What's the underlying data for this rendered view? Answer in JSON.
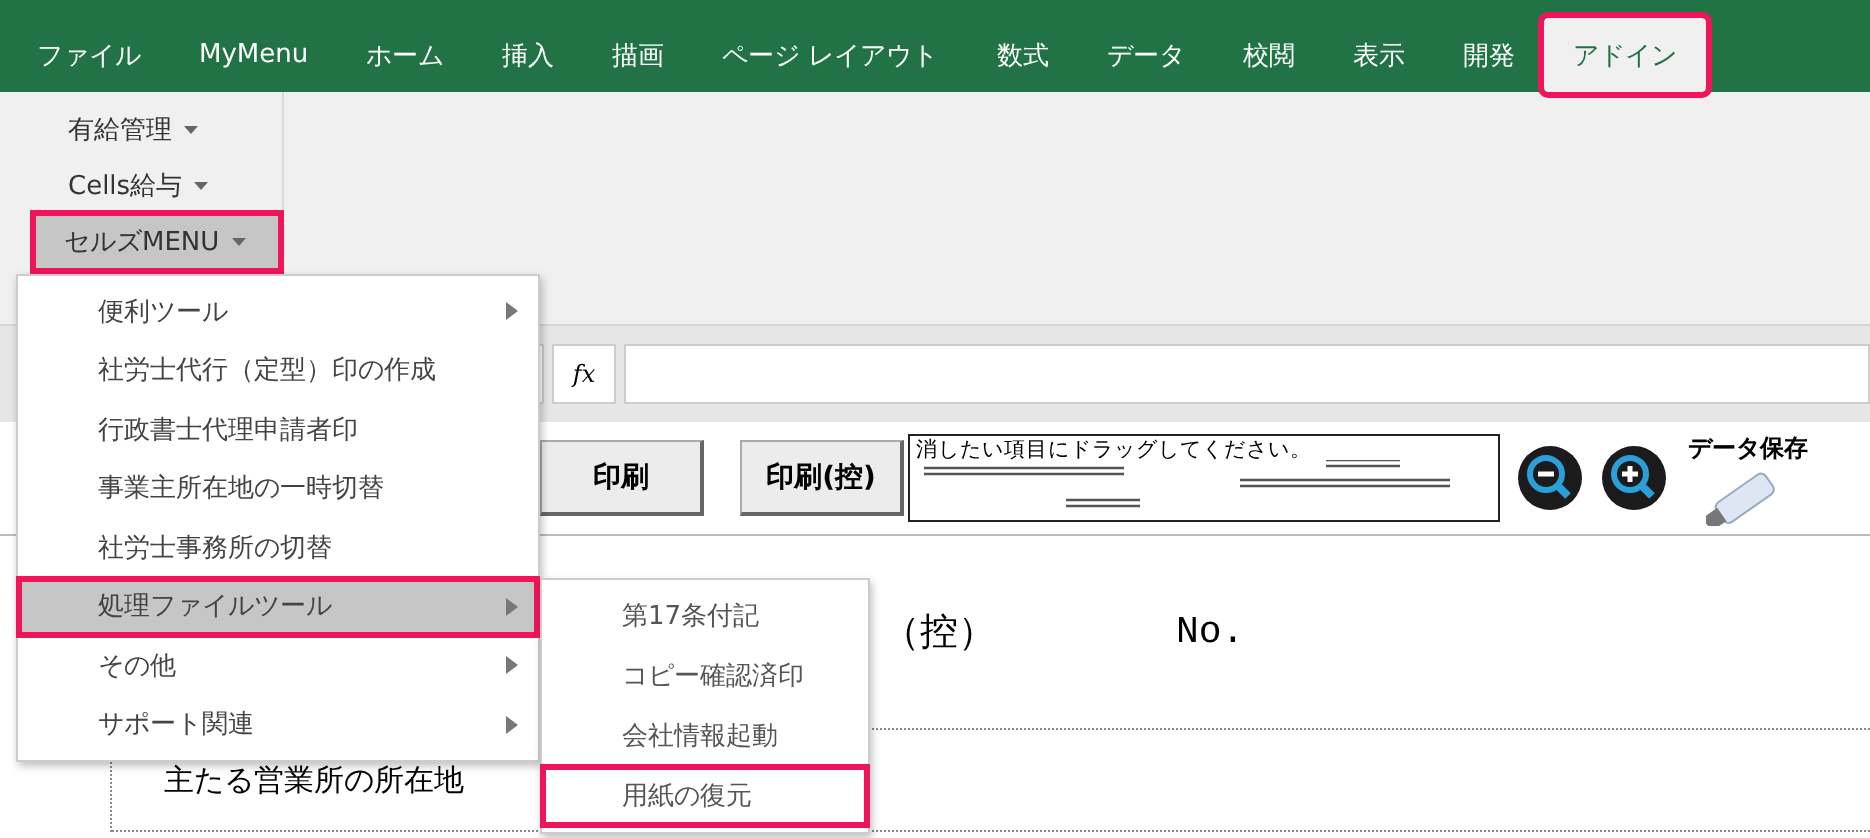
{
  "tabs": [
    {
      "label": "ファイル",
      "selected": false,
      "highlighted": false
    },
    {
      "label": "MyMenu",
      "selected": false,
      "highlighted": false
    },
    {
      "label": "ホーム",
      "selected": false,
      "highlighted": false
    },
    {
      "label": "挿入",
      "selected": false,
      "highlighted": false
    },
    {
      "label": "描画",
      "selected": false,
      "highlighted": false
    },
    {
      "label": "ページ レイアウト",
      "selected": false,
      "highlighted": false
    },
    {
      "label": "数式",
      "selected": false,
      "highlighted": false
    },
    {
      "label": "データ",
      "selected": false,
      "highlighted": false
    },
    {
      "label": "校閲",
      "selected": false,
      "highlighted": false
    },
    {
      "label": "表示",
      "selected": false,
      "highlighted": false
    },
    {
      "label": "開発",
      "selected": false,
      "highlighted": false
    },
    {
      "label": "アドイン",
      "selected": true,
      "highlighted": true
    }
  ],
  "ribbon": {
    "buttons": [
      {
        "label": "有給管理",
        "selected": false,
        "highlighted": false
      },
      {
        "label": "Cells給与",
        "selected": false,
        "highlighted": false
      },
      {
        "label": "セルズMENU",
        "selected": true,
        "highlighted": true
      }
    ]
  },
  "formula_bar": {
    "function_label": "fx"
  },
  "toolbar": {
    "buttons": [
      "印刷",
      "印刷(控)"
    ],
    "drop_hint": "消したい項目にドラッグしてください。",
    "save_label": "データ保存"
  },
  "sheet": {
    "title_suffix": "（控）",
    "number_label": "No.",
    "address_label": "主たる営業所の所在地"
  },
  "menu": {
    "items": [
      {
        "label": "便利ツール",
        "has_submenu": true,
        "selected": false,
        "highlighted": false
      },
      {
        "label": "社労士代行（定型）印の作成",
        "has_submenu": false,
        "selected": false,
        "highlighted": false
      },
      {
        "label": "行政書士代理申請者印",
        "has_submenu": false,
        "selected": false,
        "highlighted": false
      },
      {
        "label": "事業主所在地の一時切替",
        "has_submenu": false,
        "selected": false,
        "highlighted": false
      },
      {
        "label": "社労士事務所の切替",
        "has_submenu": false,
        "selected": false,
        "highlighted": false
      },
      {
        "label": "処理ファイルツール",
        "has_submenu": true,
        "selected": true,
        "highlighted": true
      },
      {
        "label": "その他",
        "has_submenu": true,
        "selected": false,
        "highlighted": false
      },
      {
        "label": "サポート関連",
        "has_submenu": true,
        "selected": false,
        "highlighted": false
      }
    ]
  },
  "submenu": {
    "items": [
      {
        "label": "第17条付記",
        "highlighted": false
      },
      {
        "label": "コピー確認済印",
        "highlighted": false
      },
      {
        "label": "会社情報起動",
        "highlighted": false
      },
      {
        "label": "用紙の復元",
        "highlighted": true
      }
    ]
  }
}
